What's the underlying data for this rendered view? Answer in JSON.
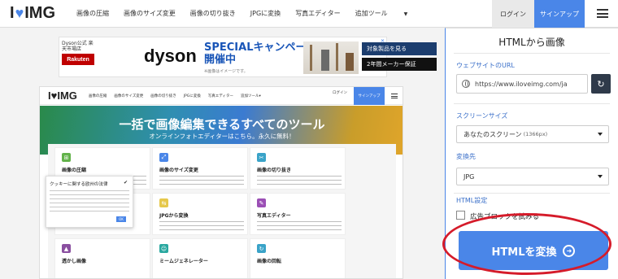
{
  "header": {
    "logo_left": "I",
    "logo_right": "IMG",
    "nav": [
      "画像の圧縮",
      "画像のサイズ変更",
      "画像の切り抜き",
      "JPGに変換",
      "写真エディター",
      "追加ツール"
    ],
    "login": "ログイン",
    "signup": "サインアップ"
  },
  "ad": {
    "store": "Dyson公式 楽天市場店",
    "rakuten_badge": "Rakuten",
    "brand": "dyson",
    "headline1": "SPECIALキャンペーン",
    "headline2": "開催中",
    "note": "※画像はイメージです。",
    "pill1": "対象製品を見る",
    "pill2": "2年間メーカー保証"
  },
  "embedded": {
    "logo": "I♥IMG",
    "nav": [
      "画像の圧縮",
      "画像のサイズ変更",
      "画像の切り抜き",
      "JPGに変換",
      "写真エディター",
      "追加ツール▾"
    ],
    "login": "ログイン",
    "signup": "サインアップ",
    "hero_title": "一括で画像編集できるすべてのツール",
    "hero_sub": "オンラインフォトエディターはこちら。永久に無料！",
    "cards": [
      {
        "title": "画像の圧縮",
        "color": "#62b24a",
        "icon": "compress-icon"
      },
      {
        "title": "画像のサイズ変更",
        "color": "#4a86e8",
        "icon": "resize-icon"
      },
      {
        "title": "画像の切り抜き",
        "color": "#3aa3c8",
        "icon": "crop-icon"
      },
      {
        "title": "",
        "color": "#e6b800",
        "icon": "convert-icon"
      },
      {
        "title": "JPGから変換",
        "color": "#e6c84a",
        "icon": "from-jpg-icon"
      },
      {
        "title": "写真エディター",
        "color": "#9b4fb5",
        "icon": "edit-icon"
      },
      {
        "title": "透かし画像",
        "color": "#8a4fa0",
        "icon": "watermark-icon"
      },
      {
        "title": "ミームジェネレーター",
        "color": "#2aa8a0",
        "icon": "meme-icon"
      },
      {
        "title": "画像の回転",
        "color": "#3aa3c8",
        "icon": "rotate-icon"
      }
    ],
    "cookie_title": "クッキーに関する欧州の法律"
  },
  "panel": {
    "title": "HTMLから画像",
    "url_label": "ウェブサイトのURL",
    "url_value": "https://www.iloveimg.com/ja",
    "screen_label": "スクリーンサイズ",
    "screen_value": "あなたのスクリーン",
    "screen_sub": "(1366px)",
    "convert_label": "変換先",
    "convert_value": "JPG",
    "html_settings": "HTML設定",
    "adblock": "広告ブロックを試みる",
    "convert_button": "HTMLを変換"
  }
}
